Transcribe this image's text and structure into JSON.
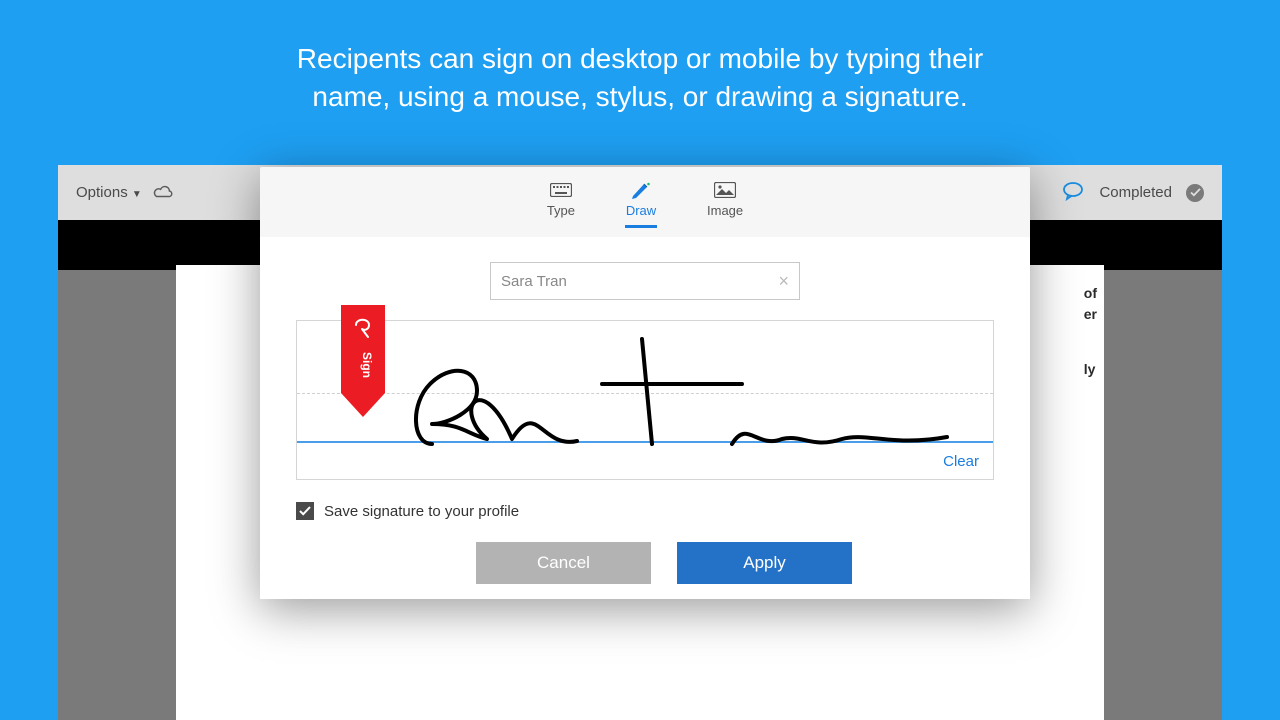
{
  "caption_line1": "Recipents can sign on desktop or mobile by typing their",
  "caption_line2": "name, using a mouse, stylus, or drawing a signature.",
  "header": {
    "options_label": "Options",
    "completed_label": "Completed"
  },
  "right_snippets": {
    "a": "of",
    "b": "er",
    "c": "ly"
  },
  "dialog": {
    "tabs": {
      "type": "Type",
      "draw": "Draw",
      "image": "Image",
      "active": "draw"
    },
    "name_value": "Sara Tran",
    "clear_label": "Clear",
    "save_label": "Save signature to your profile",
    "save_checked": true,
    "cancel_label": "Cancel",
    "apply_label": "Apply",
    "sign_flag_label": "Sign"
  }
}
